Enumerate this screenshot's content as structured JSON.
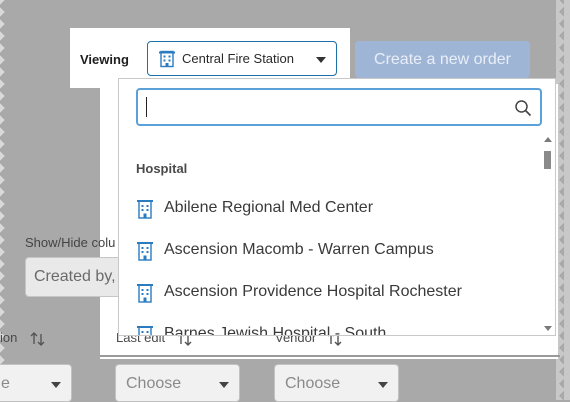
{
  "header": {
    "viewing_label": "Viewing",
    "location_value": "Central Fire Station",
    "create_label": "Create a new order"
  },
  "dropdown": {
    "search_value": "",
    "section": "Hospital",
    "items": [
      "Abilene Regional Med Center",
      "Ascension Macomb - Warren Campus",
      "Ascension Providence Hospital Rochester",
      "Barnes Jewish Hospital - South"
    ]
  },
  "background": {
    "showhide_label": "Show/Hide colu",
    "showhide_value": "Created by,",
    "columns": {
      "col1": "ion",
      "col2": "Last edit",
      "col3": "Vendor"
    },
    "filters": {
      "f1": "e",
      "f2": "Choose",
      "f3": "Choose"
    }
  },
  "colors": {
    "accent_blue": "#1d6fa8",
    "search_border": "#5ba0d8",
    "create_button_disabled": "#9fb5d6"
  },
  "icons": {
    "building": "building-icon",
    "search": "search-icon",
    "sort": "sort-arrows-icon",
    "chevron": "chevron-down-icon"
  }
}
